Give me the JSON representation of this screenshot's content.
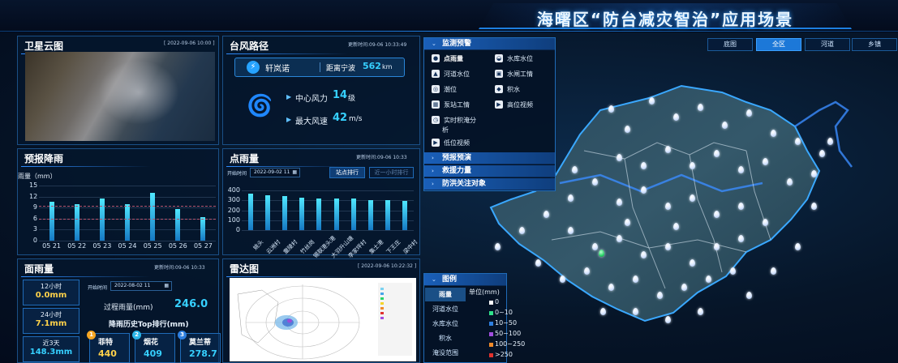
{
  "header": {
    "title": "海曙区“防台减灾智治”应用场景"
  },
  "satellite": {
    "title": "卫星云图",
    "time": "[ 2022-09-06 10:00 ]"
  },
  "typhoon": {
    "title": "台风路径",
    "update": "更新时间:09-06 10:33:49",
    "name": "轩岚诺",
    "distance_label": "距离宁波",
    "distance_value": "562",
    "distance_unit": "km",
    "wind_label": "中心风力",
    "wind_value": "14",
    "wind_unit": "级",
    "speed_label": "最大风速",
    "speed_value": "42",
    "speed_unit": "m/s"
  },
  "forecast": {
    "title": "预报降雨",
    "ylabel": "雨量（mm）",
    "chart_data": {
      "type": "bar",
      "title": "",
      "xlabel": "",
      "ylabel": "雨量（mm）",
      "categories": [
        "05 21",
        "05 22",
        "05 23",
        "05 24",
        "05 25",
        "05 26",
        "05 27"
      ],
      "values": [
        10.5,
        10,
        11.5,
        10,
        13,
        8.5,
        6.5
      ],
      "ylim": [
        0,
        15
      ],
      "yticks": [
        "15",
        "12",
        "9",
        "6",
        "3",
        "0"
      ],
      "grid": true
    }
  },
  "points": {
    "title": "点雨量",
    "update": "更新时间:09-06 10:33",
    "start_label": "开始时间",
    "start_date": "2022-09-02 11",
    "btn_rank": "站点排行",
    "btn_hour": "近一小时排行",
    "chart_data": {
      "type": "bar",
      "title": "",
      "xlabel": "",
      "ylabel": "",
      "categories": [
        "姚头",
        "云洲村",
        "童陵村",
        "竹丝岗",
        "锡联港头港",
        "大羽升山塘",
        "李家坪村",
        "集士港",
        "下王庄",
        "梁中村"
      ],
      "values": [
        365,
        355,
        345,
        330,
        320,
        318,
        315,
        305,
        300,
        295
      ],
      "ylim": [
        0,
        400
      ],
      "yticks": [
        "400",
        "300",
        "200",
        "100",
        "0"
      ],
      "grid": true
    }
  },
  "rainfall": {
    "title": "面雨量",
    "update": "更新时间:09-06 10:33",
    "start_label": "开始时间",
    "start_date": "2022-08-02 11",
    "process_label": "过程雨量(mm)",
    "process_value": "246.0",
    "history_label": "降雨历史Top排行(mm)",
    "summary": [
      {
        "label": "12小时",
        "value": "0.0mm"
      },
      {
        "label": "24小时",
        "value": "7.1mm"
      },
      {
        "label": "近3天",
        "value": "148.3mm"
      }
    ],
    "top": [
      {
        "rank": "1",
        "name": "菲特",
        "value": "440",
        "color": "#f5a623"
      },
      {
        "rank": "2",
        "name": "烟花",
        "value": "409",
        "color": "#2bb6e8"
      },
      {
        "rank": "3",
        "name": "莫兰蒂",
        "value": "278.7",
        "color": "#2e7fe0"
      }
    ]
  },
  "radar": {
    "title": "雷达图",
    "time": "[ 2022-09-06 10:22:32 ]"
  },
  "map_tabs": [
    {
      "label": "底图",
      "active": false
    },
    {
      "label": "全区",
      "active": true
    },
    {
      "label": "河道",
      "active": false
    },
    {
      "label": "乡镇",
      "active": false
    }
  ],
  "menu": {
    "monitor": "监测预警",
    "items": [
      "点雨量",
      "水库水位",
      "河道水位",
      "水闸工情",
      "潮位",
      "积水",
      "泵站工情",
      "高位视频",
      "实时积淹分",
      "析",
      "低位视频"
    ],
    "forecast": "预报预演",
    "rescue": "救援力量",
    "focus": "防洪关注对象"
  },
  "legend": {
    "title": "图例",
    "unit_label": "单位(mm)",
    "tabs": [
      "雨量",
      "河道水位",
      "水库水位",
      "积水",
      "淹没范围"
    ],
    "ranges": [
      {
        "label": "0",
        "color": "#ffffff"
      },
      {
        "label": "0~10",
        "color": "#2fe28a"
      },
      {
        "label": "10~50",
        "color": "#2e7fe0"
      },
      {
        "label": "50~100",
        "color": "#a24ee0"
      },
      {
        "label": "100~250",
        "color": "#f08a2a"
      },
      {
        "label": ">250",
        "color": "#e0322e"
      }
    ]
  }
}
